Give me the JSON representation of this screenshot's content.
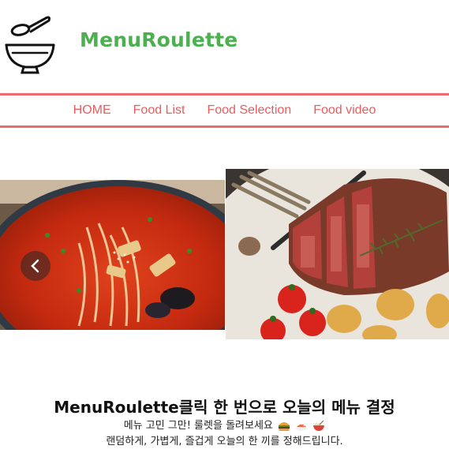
{
  "brand": {
    "name": "MenuRoulette",
    "logo_icon": "bowl-spoon-icon",
    "color": "#4caf50"
  },
  "nav": {
    "accent": "#ef6b6b",
    "items": [
      "HOME",
      "Food List",
      "Food Selection",
      "Food video"
    ]
  },
  "carousel": {
    "prev_icon": "chevron-left-icon",
    "slides": [
      {
        "subject": "spicy-noodle-soup-image"
      },
      {
        "subject": "sliced-steak-image"
      }
    ]
  },
  "intro": {
    "title": "MenuRoulette클릭 한 번으로 오늘의 메뉴 결정",
    "line1": "메뉴 고민 그만! 룰렛을 돌려보세요",
    "emojis": [
      "hamburger-emoji",
      "sushi-emoji",
      "ramen-emoji"
    ],
    "line2": "랜덤하게, 가볍게, 즐겁게 오늘의 한 끼를 정해드립니다."
  }
}
